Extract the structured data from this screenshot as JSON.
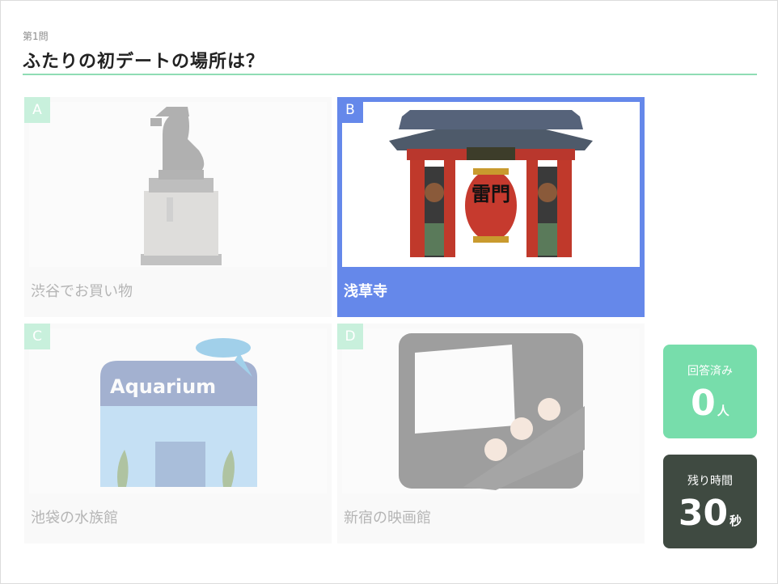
{
  "question": {
    "number_label": "第1問",
    "title": "ふたりの初デートの場所は？"
  },
  "options": [
    {
      "letter": "A",
      "label": "渋谷でお買い物",
      "icon": "hachiko-statue-icon",
      "selected": false
    },
    {
      "letter": "B",
      "label": "浅草寺",
      "icon": "kaminarimon-gate-icon",
      "selected": true,
      "lantern_text": "雷門"
    },
    {
      "letter": "C",
      "label": "池袋の水族館",
      "icon": "aquarium-icon",
      "selected": false,
      "sign_text": "Aquarium"
    },
    {
      "letter": "D",
      "label": "新宿の映画館",
      "icon": "movie-theater-icon",
      "selected": false
    }
  ],
  "stats": {
    "answered": {
      "title": "回答済み",
      "value": "0",
      "unit": "人"
    },
    "remaining": {
      "title": "残り時間",
      "value": "30",
      "unit": "秒"
    }
  },
  "colors": {
    "accent_line": "#8fdcb4",
    "selected": "#6588ea",
    "answered_bg": "#77ddab",
    "timer_bg": "#3f4a41"
  }
}
